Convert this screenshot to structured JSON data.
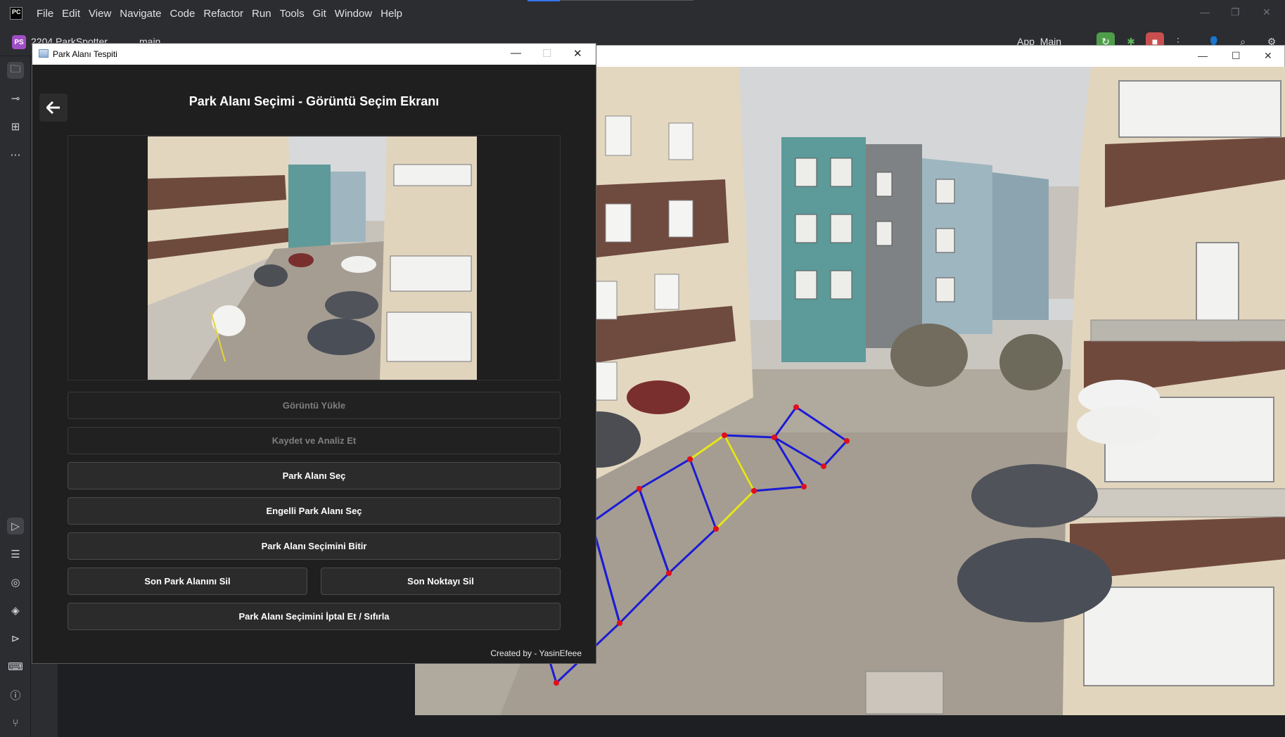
{
  "ide": {
    "menu": [
      "File",
      "Edit",
      "View",
      "Navigate",
      "Code",
      "Refactor",
      "Run",
      "Tools",
      "Git",
      "Window",
      "Help"
    ],
    "project_badge": "PS",
    "project_name": "2204 ParkSpotter",
    "branch": "main",
    "run_config": "App_Main"
  },
  "app": {
    "window_title": "Park Alanı Tespiti",
    "heading": "Park Alanı Seçimi - Görüntü Seçim Ekranı",
    "buttons": {
      "load_image": "Görüntü Yükle",
      "save_analyze": "Kaydet ve Analiz Et",
      "select_spot": "Park Alanı Seç",
      "select_disabled_spot": "Engelli Park Alanı Seç",
      "finish_selection": "Park Alanı Seçimini Bitir",
      "delete_last_spot": "Son Park Alanını Sil",
      "delete_last_point": "Son Noktayı Sil",
      "cancel_reset": "Park Alanı Seçimini İptal Et / Sıfırla"
    },
    "footer": "Created by - YasinEfeee"
  },
  "colors": {
    "spot_outline": "#1b1bd6",
    "disabled_spot_outline": "#e6e61a",
    "spot_vertex": "#e0101a"
  }
}
